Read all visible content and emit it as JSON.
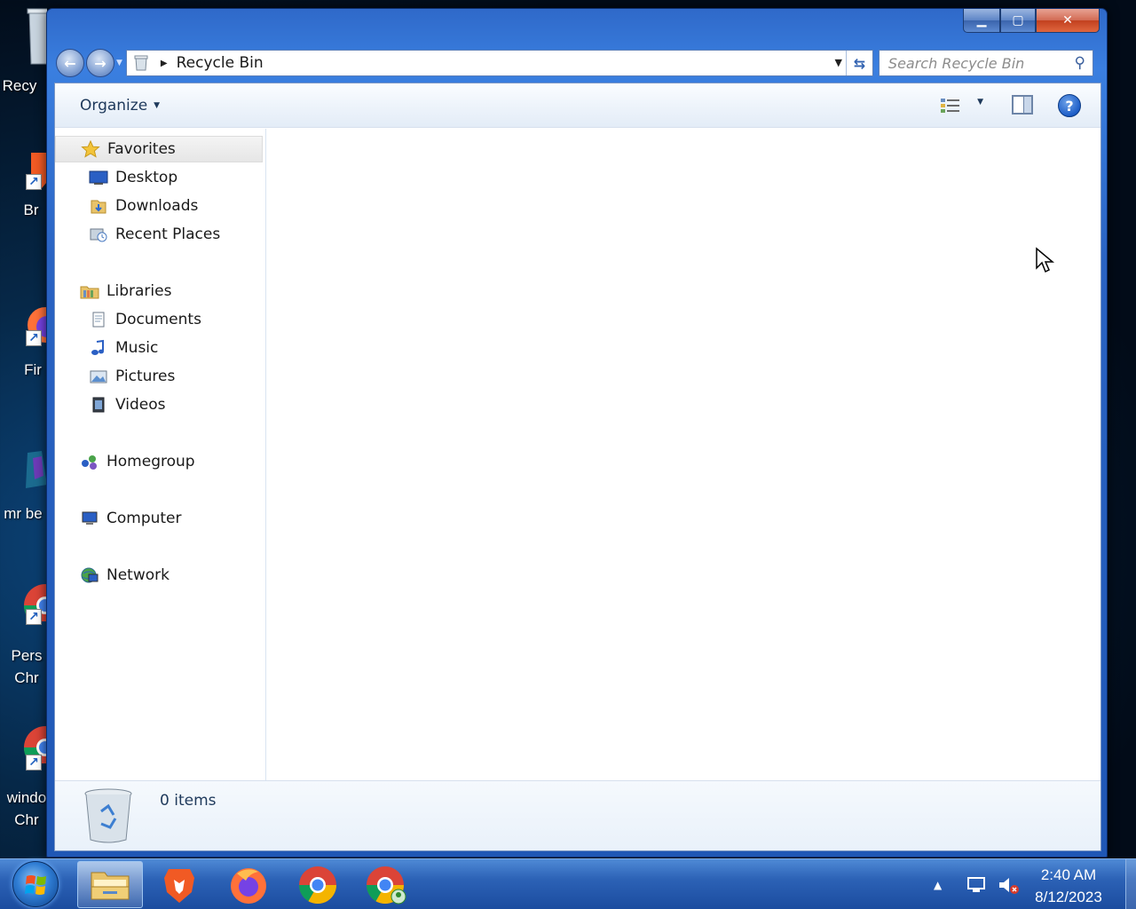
{
  "desktop": {
    "icons": [
      {
        "label": "Recy"
      },
      {
        "label": "Br"
      },
      {
        "label": "Fir"
      },
      {
        "label": "mr be"
      },
      {
        "label": "Pers\nChr"
      },
      {
        "label": "windo\nChr"
      }
    ]
  },
  "window": {
    "caption": {
      "minimize": "▁",
      "maximize": "▢",
      "close": "✕"
    },
    "nav": {
      "back": "←",
      "forward": "→"
    },
    "address": {
      "current": "Recycle Bin"
    },
    "search": {
      "placeholder": "Search Recycle Bin"
    },
    "toolbar": {
      "organize": "Organize",
      "help": "?"
    },
    "navpane": {
      "favorites": "Favorites",
      "desktop": "Desktop",
      "downloads": "Downloads",
      "recent": "Recent Places",
      "libraries": "Libraries",
      "documents": "Documents",
      "music": "Music",
      "pictures": "Pictures",
      "videos": "Videos",
      "homegroup": "Homegroup",
      "computer": "Computer",
      "network": "Network"
    },
    "details": {
      "count": "0 items"
    }
  },
  "taskbar": {
    "time": "2:40 AM",
    "date": "8/12/2023"
  },
  "colors": {
    "accent": "#2a63c2",
    "taskbar": "#2c62b6"
  }
}
